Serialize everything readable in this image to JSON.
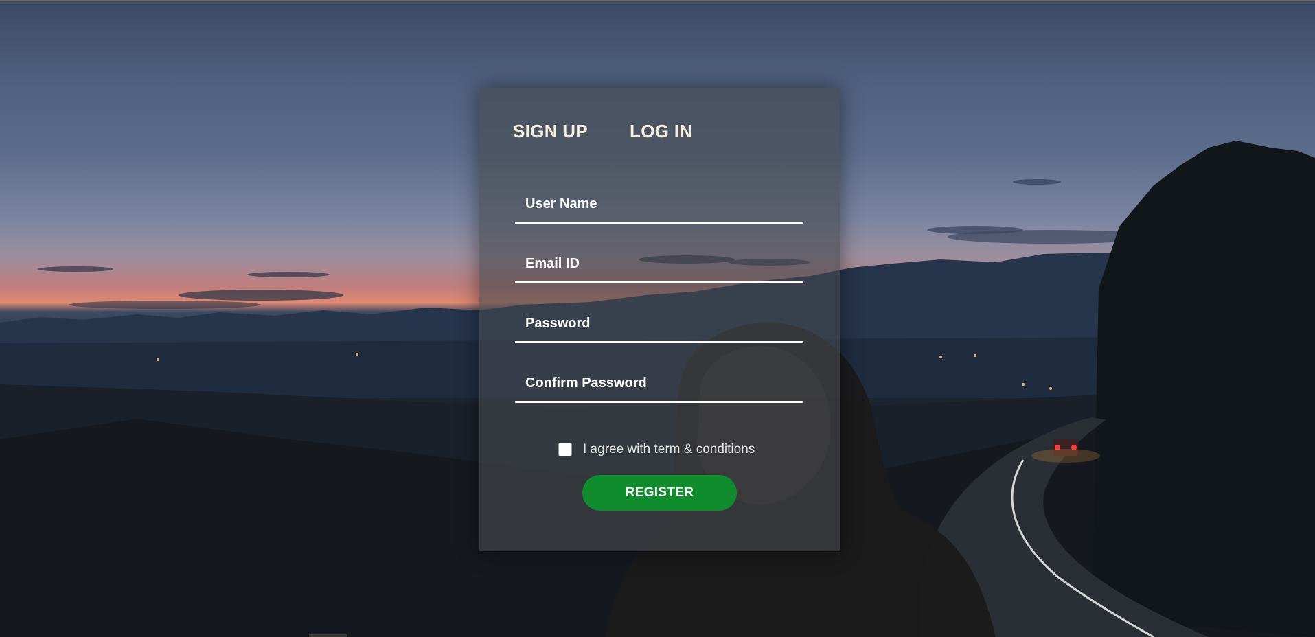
{
  "tabs": {
    "signup_label": "SIGN UP",
    "login_label": "LOG IN"
  },
  "form": {
    "username_placeholder": "User Name",
    "email_placeholder": "Email ID",
    "password_placeholder": "Password",
    "confirm_password_placeholder": "Confirm Password",
    "agree_label": "I agree with term & conditions",
    "agree_checked": false,
    "register_label": "REGISTER"
  },
  "colors": {
    "tab_text": "#f4f0dd",
    "register_button": "#0f8c2c",
    "field_underline": "#ffffff"
  }
}
